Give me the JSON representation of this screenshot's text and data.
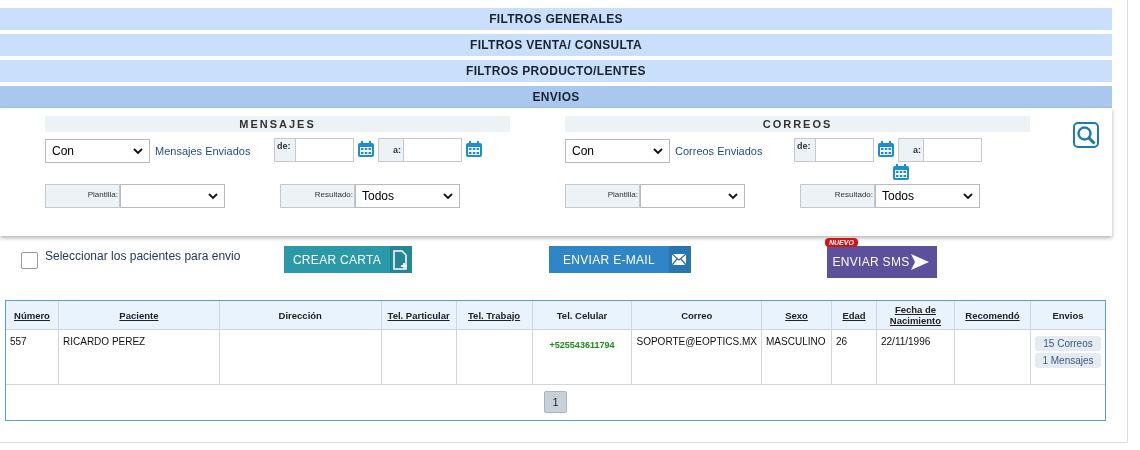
{
  "accordion": [
    {
      "label": "FILTROS GENERALES",
      "expanded": false
    },
    {
      "label": "FILTROS VENTA/ CONSULTA",
      "expanded": false
    },
    {
      "label": "FILTROS PRODUCTO/LENTES",
      "expanded": false
    },
    {
      "label": "ENVIOS",
      "expanded": true
    }
  ],
  "filters": [
    {
      "title": "MENSAJES",
      "mode": "Con",
      "link": "Mensajes Enviados",
      "from_label": "de:",
      "to_label": "a:",
      "template_label": "Plantilla:",
      "result_label": "Resultado:",
      "result": "Todos",
      "wrap_calendar": false
    },
    {
      "title": "CORREOS",
      "mode": "Con",
      "link": "Correos Enviados",
      "from_label": "de:",
      "to_label": "a:",
      "template_label": "Plantilla:",
      "result_label": "Resultado:",
      "result": "Todos",
      "wrap_calendar": true
    }
  ],
  "select_patients": {
    "label": "Seleccionar los pacientes para envio",
    "checked": false
  },
  "actions": [
    {
      "label": "CREAR CARTA",
      "kind": "letter",
      "color": "#2a9aa8"
    },
    {
      "label": "ENVIAR E-MAIL",
      "kind": "email",
      "color": "#2f86c6"
    },
    {
      "label": "ENVIAR SMS",
      "kind": "sms",
      "color": "#5c4f9c",
      "badge": "NUEVO"
    }
  ],
  "table": {
    "columns": [
      {
        "label": "Número",
        "sortable": true,
        "kind": "text"
      },
      {
        "label": "Paciente",
        "sortable": true,
        "kind": "text"
      },
      {
        "label": "Dirección",
        "sortable": false,
        "kind": "text"
      },
      {
        "label": "Tel. Particular",
        "sortable": true,
        "kind": "text"
      },
      {
        "label": "Tel. Trabajo",
        "sortable": true,
        "kind": "text"
      },
      {
        "label": "Tel. Celular",
        "sortable": false,
        "kind": "phone"
      },
      {
        "label": "Correo",
        "sortable": false,
        "kind": "center"
      },
      {
        "label": "Sexo",
        "sortable": true,
        "kind": "text"
      },
      {
        "label": "Edad",
        "sortable": true,
        "kind": "text"
      },
      {
        "label": "Fecha de Nacimiento",
        "sortable": true,
        "kind": "text"
      },
      {
        "label": "Recomendó",
        "sortable": true,
        "kind": "text"
      },
      {
        "label": "Envios",
        "sortable": false,
        "kind": "envios"
      }
    ],
    "rows": [
      {
        "cells": [
          "557",
          "RICARDO PEREZ",
          "",
          "",
          "",
          "+525543611794",
          "SOPORTE@EOPTICS.MX",
          "MASCULINO",
          "26",
          "22/11/1996",
          "",
          ""
        ],
        "envios": [
          "15 Correos",
          "1 Mensajes"
        ]
      }
    ]
  },
  "pager": [
    {
      "label": "1",
      "selected": true
    }
  ]
}
